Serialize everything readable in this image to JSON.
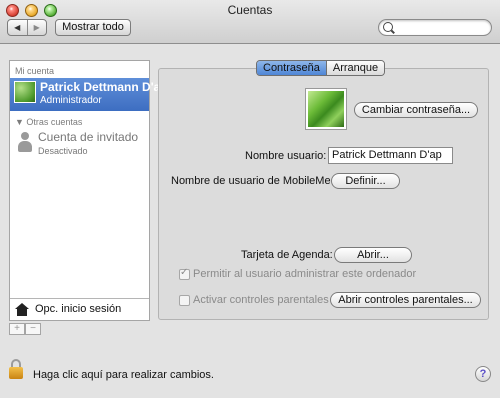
{
  "window": {
    "title": "Cuentas"
  },
  "toolbar": {
    "back": "◀",
    "forward": "▶",
    "show_all": "Mostrar todo",
    "search_placeholder": ""
  },
  "sidebar": {
    "my_account_header": "Mi cuenta",
    "selected_user": {
      "name": "Patrick Dettmann D'a…",
      "role": "Administrador"
    },
    "other_accounts_header": "▼ Otras cuentas",
    "guest": {
      "name": "Cuenta de invitado",
      "status": "Desactivado"
    },
    "login_options": "Opc. inicio sesión",
    "add": "+",
    "remove": "−"
  },
  "tabs": [
    {
      "label": "Contraseña",
      "active": true
    },
    {
      "label": "Arranque",
      "active": false
    }
  ],
  "form": {
    "change_password": "Cambiar contraseña...",
    "username_label": "Nombre usuario:",
    "username_value": "Patrick Dettmann D'ap",
    "mobileme_label": "Nombre de usuario de MobileMe:",
    "mobileme_button": "Definir...",
    "agenda_label": "Tarjeta de Agenda:",
    "agenda_button": "Abrir...",
    "allow_admin_label": "Permitir al usuario administrar este ordenador",
    "allow_admin_checked": true,
    "parental_label": "Activar controles parentales",
    "parental_checked": false,
    "parental_button": "Abrir controles parentales..."
  },
  "footer": {
    "lock_text": "Haga clic aquí para realizar cambios.",
    "help": "?"
  }
}
